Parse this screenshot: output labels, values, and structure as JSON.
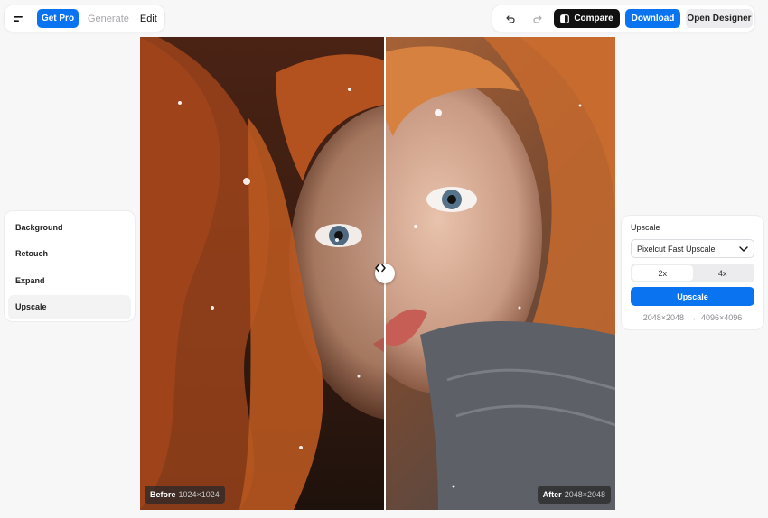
{
  "topbar": {
    "menu_icon": "menu-icon",
    "get_pro": "Get Pro",
    "generate": "Generate",
    "edit": "Edit",
    "undo_icon": "undo-icon",
    "redo_icon": "redo-icon",
    "compare": "Compare",
    "download": "Download",
    "open_designer": "Open Designer"
  },
  "sidebar": {
    "items": [
      {
        "label": "Background"
      },
      {
        "label": "Retouch"
      },
      {
        "label": "Expand"
      },
      {
        "label": "Upscale"
      }
    ],
    "active": "Upscale"
  },
  "comparison": {
    "before_label": "Before",
    "before_size": "1024×1024",
    "after_label": "After",
    "after_size": "2048×2048",
    "handle_icon": "code-arrows-icon"
  },
  "upscale_panel": {
    "title": "Upscale",
    "model": "Pixelcut Fast Upscale",
    "scale_options": [
      "2x",
      "4x"
    ],
    "selected_scale": "2x",
    "button": "Upscale",
    "from_res": "2048×2048",
    "arrow": "→",
    "to_res": "4096×4096"
  },
  "colors": {
    "accent": "#0a74f0",
    "dark": "#111111"
  }
}
